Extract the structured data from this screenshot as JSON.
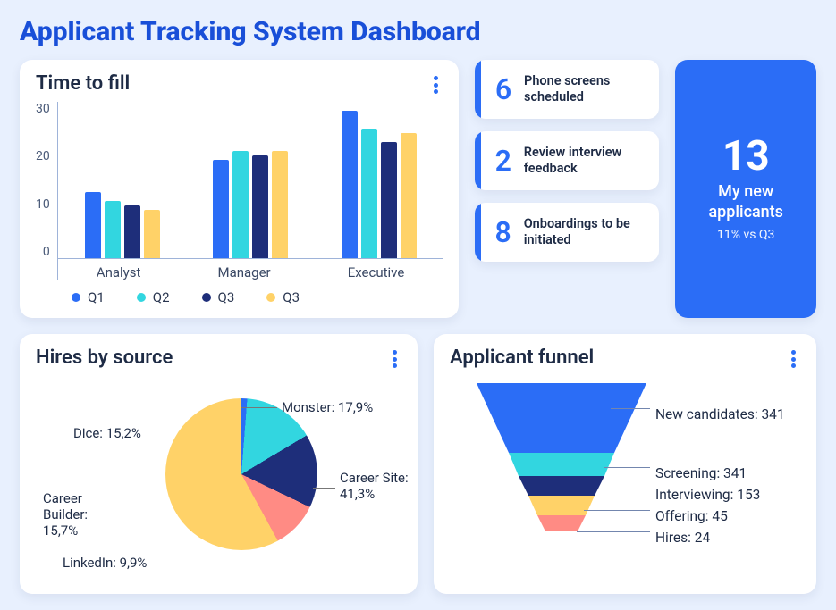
{
  "page_title": "Applicant Tracking System Dashboard",
  "time_to_fill_card": {
    "title": "Time to fill",
    "y_ticks": [
      "30",
      "20",
      "10",
      "0"
    ],
    "categories": [
      "Analyst",
      "Manager",
      "Executive"
    ],
    "legend": [
      "Q1",
      "Q2",
      "Q3",
      "Q3"
    ]
  },
  "tasks": [
    {
      "num": "6",
      "text": "Phone screens scheduled"
    },
    {
      "num": "2",
      "text": "Review interview feedback"
    },
    {
      "num": "8",
      "text": "Onboardings to be initiated"
    }
  ],
  "kpi": {
    "value": "13",
    "label": "My new applicants",
    "sub": "11% vs Q3"
  },
  "hires_card": {
    "title": "Hires by source",
    "labels": {
      "monster": "Monster: 17,9%",
      "dice": "Dice: 15,2%",
      "career_builder": "Career Builder: 15,7%",
      "linkedin": "LinkedIn: 9,9%",
      "career_site": "Career Site: 41,3%"
    }
  },
  "funnel_card": {
    "title": "Applicant funnel",
    "labels": {
      "new": "New candidates: 341",
      "screening": "Screening: 341",
      "interview": "Interviewing: 153",
      "offering": "Offering: 45",
      "hires": "Hires: 24"
    }
  },
  "colors": {
    "q1": "#2b6df6",
    "q2": "#32d6e0",
    "q3": "#1e2e7a",
    "q4": "#ffd268",
    "coral": "#ff8b84"
  },
  "chart_data": [
    {
      "type": "bar",
      "title": "Time to fill",
      "categories": [
        "Analyst",
        "Manager",
        "Executive"
      ],
      "series": [
        {
          "name": "Q1",
          "color": "#2b6df6",
          "values": [
            15,
            22,
            33
          ]
        },
        {
          "name": "Q2",
          "color": "#32d6e0",
          "values": [
            13,
            24,
            29
          ]
        },
        {
          "name": "Q3",
          "color": "#1e2e7a",
          "values": [
            12,
            23,
            26
          ]
        },
        {
          "name": "Q3",
          "color": "#ffd268",
          "values": [
            11,
            24,
            28
          ]
        }
      ],
      "ylim": [
        0,
        35
      ],
      "y_ticks": [
        0,
        10,
        20,
        30
      ]
    },
    {
      "type": "pie",
      "title": "Hires by source",
      "series": [
        {
          "name": "Career Site",
          "value": 41.3,
          "color": "#ffd268"
        },
        {
          "name": "Monster",
          "value": 17.9,
          "color": "#2b6df6"
        },
        {
          "name": "Dice",
          "value": 15.2,
          "color": "#32d6e0"
        },
        {
          "name": "Career Builder",
          "value": 15.7,
          "color": "#1e2e7a"
        },
        {
          "name": "LinkedIn",
          "value": 9.9,
          "color": "#ff8b84"
        }
      ]
    },
    {
      "type": "funnel",
      "title": "Applicant funnel",
      "stages": [
        {
          "name": "New candidates",
          "value": 341,
          "color": "#2b6df6"
        },
        {
          "name": "Screening",
          "value": 341,
          "color": "#32d6e0"
        },
        {
          "name": "Interviewing",
          "value": 153,
          "color": "#1e2e7a"
        },
        {
          "name": "Offering",
          "value": 45,
          "color": "#ffd268"
        },
        {
          "name": "Hires",
          "value": 24,
          "color": "#ff8b84"
        }
      ]
    }
  ]
}
